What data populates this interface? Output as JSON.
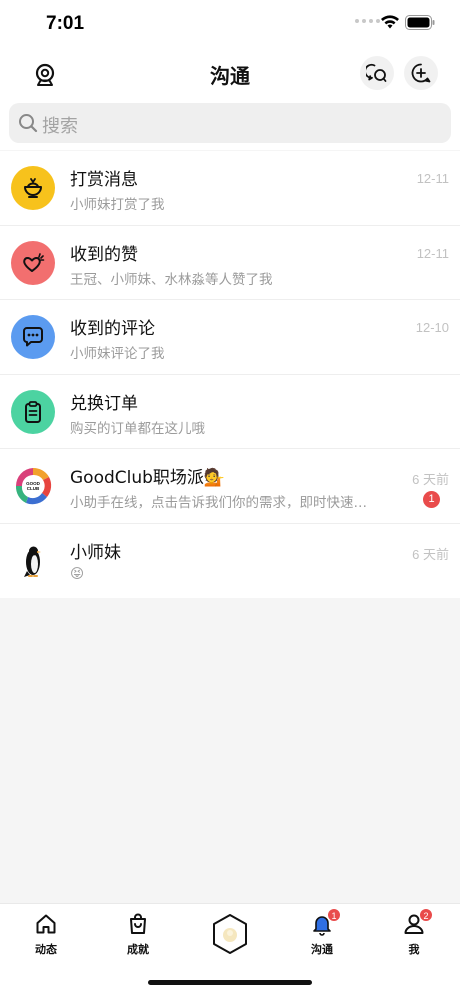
{
  "status_bar": {
    "time": "7:01"
  },
  "header": {
    "title": "沟通"
  },
  "search": {
    "placeholder": "搜索"
  },
  "conversations": [
    {
      "title": "打赏消息",
      "subtitle": "小师妹打赏了我",
      "time": "12-11",
      "icon": "reward-bowl-icon",
      "color": "#f7c21c",
      "unread": ""
    },
    {
      "title": "收到的赞",
      "subtitle": "王冠、小师妹、水林淼等人赞了我",
      "time": "12-11",
      "icon": "heart-icon",
      "color": "#f26f6f",
      "unread": ""
    },
    {
      "title": "收到的评论",
      "subtitle": "小师妹评论了我",
      "time": "12-10",
      "icon": "comment-icon",
      "color": "#5b9bf0",
      "unread": ""
    },
    {
      "title": "兑换订单",
      "subtitle": "购买的订单都在这儿哦",
      "time": "",
      "icon": "clipboard-icon",
      "color": "#4cd3a1",
      "unread": ""
    },
    {
      "title": "GoodClub职场派💁",
      "subtitle": "小助手在线，点击告诉我们你的需求，即时快速…",
      "time": "6 天前",
      "icon": "goodclub-logo",
      "color": "#ffffff",
      "unread": "1"
    },
    {
      "title": "小师妹",
      "subtitle": "😝",
      "time": "6 天前",
      "icon": "penguin-avatar",
      "color": "#ffffff",
      "unread": ""
    }
  ],
  "tabbar": {
    "items": [
      {
        "label": "动态",
        "icon": "home-icon",
        "badge": ""
      },
      {
        "label": "成就",
        "icon": "bag-icon",
        "badge": ""
      },
      {
        "label": "",
        "icon": "hexagon-center-icon",
        "badge": ""
      },
      {
        "label": "沟通",
        "icon": "bell-icon",
        "badge": "1"
      },
      {
        "label": "我",
        "icon": "person-icon",
        "badge": "2"
      }
    ]
  }
}
